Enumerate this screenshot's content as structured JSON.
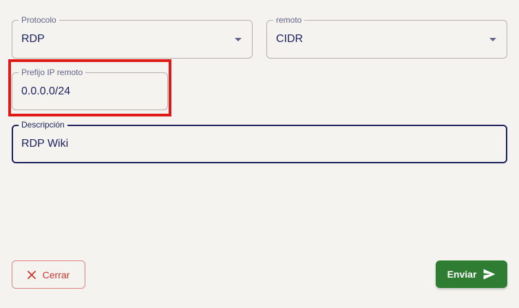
{
  "form": {
    "protocol": {
      "label": "Protocolo",
      "value": "RDP",
      "icon": "chevron-down-icon"
    },
    "remote": {
      "label": "remoto",
      "value": "CIDR",
      "icon": "chevron-down-icon"
    },
    "remote_ip_prefix": {
      "label": "Prefijo IP remoto",
      "value": "0.0.0.0/24"
    },
    "description": {
      "label": "Descripción",
      "value": "RDP Wiki"
    }
  },
  "actions": {
    "close_label": "Cerrar",
    "close_icon": "close-icon",
    "send_label": "Enviar",
    "send_icon": "send-icon"
  },
  "colors": {
    "background": "#f5f3f0",
    "text_primary": "#1a1f5a",
    "label": "#5f6385",
    "border": "#b3b0ab",
    "highlight": "#e01818",
    "close_text": "#c8342c",
    "close_border": "#d9827d",
    "send_bg": "#2e7d32"
  }
}
